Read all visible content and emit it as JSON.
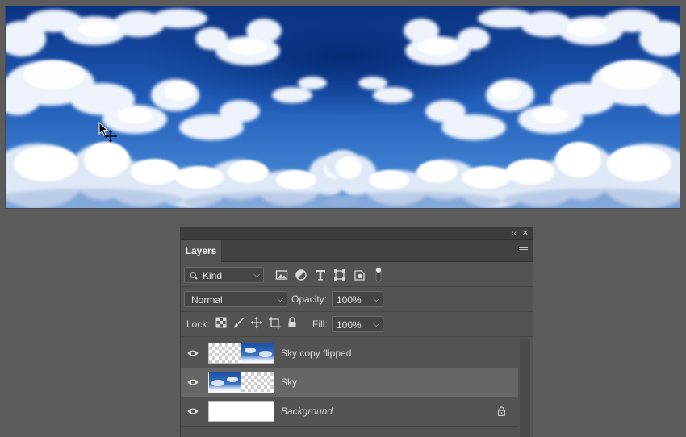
{
  "canvas": {
    "image_name": "mirrored-sky-image"
  },
  "panel": {
    "collapse_label": "‹‹",
    "close_label": "✕",
    "tab_label": "Layers",
    "filter": {
      "kind_label": "Kind"
    },
    "blend": {
      "mode": "Normal",
      "opacity_label": "Opacity:",
      "opacity_value": "100%"
    },
    "lock": {
      "lock_label": "Lock:",
      "fill_label": "Fill:",
      "fill_value": "100%"
    },
    "layers": [
      {
        "name": "Sky copy flipped",
        "visible": true,
        "selected": false
      },
      {
        "name": "Sky",
        "visible": true,
        "selected": true
      },
      {
        "name": "Background",
        "visible": true,
        "selected": false,
        "locked": true
      }
    ]
  },
  "colors": {
    "panel_bg": "#535353",
    "workspace_bg": "#5c5c5c",
    "selected_row": "#666666",
    "sky_deep": "#0b3a8a"
  }
}
